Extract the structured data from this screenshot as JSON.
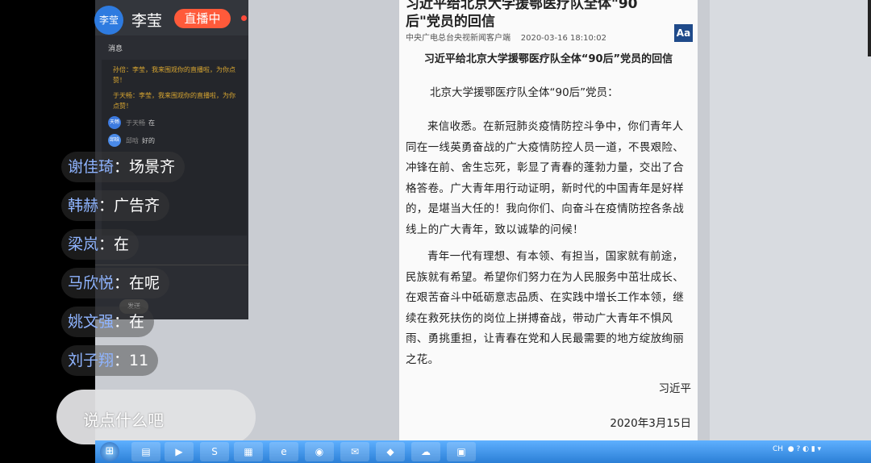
{
  "live": {
    "avatar_text": "李莹",
    "host_name": "李莹",
    "status_badge": "直播中"
  },
  "chat_panel": {
    "messages_label": "消息",
    "system_messages": [
      "孙倍：李莹，我来围观你的直播啦，为你点赞！",
      "于天畅：李莹，我来围观你的直播啦，为你点赞！"
    ],
    "user_messages": [
      {
        "avatar": "天畅",
        "name": "于天畅",
        "text": "在"
      },
      {
        "avatar": "邱晗",
        "name": "邱晗",
        "text": "好的"
      }
    ],
    "send_label": "发送"
  },
  "article": {
    "header_title": "习近平给北京大学援鄂医疗队全体\"90后\"党员的回信",
    "source": "中央广电总台央视新闻客户端",
    "datetime": "2020-03-16 18:10:02",
    "font_button": "Aa",
    "letter_title": "习近平给北京大学援鄂医疗队全体“90后”党员的回信",
    "salutation": "北京大学援鄂医疗队全体“90后”党员：",
    "paragraph1": "来信收悉。在新冠肺炎疫情防控斗争中，你们青年人同在一线英勇奋战的广大疫情防控人员一道，不畏艰险、冲锋在前、舍生忘死，彰显了青春的蓬勃力量，交出了合格答卷。广大青年用行动证明，新时代的中国青年是好样的，是堪当大任的！我向你们、向奋斗在疫情防控各条战线上的广大青年，致以诚挚的问候！",
    "paragraph2": "青年一代有理想、有本领、有担当，国家就有前途，民族就有希望。希望你们努力在为人民服务中茁壮成长、在艰苦奋斗中砥砺意志品质、在实践中增长工作本领，继续在救死扶伤的岗位上拼搏奋战，带动广大青年不惧风雨、勇挑重担，让青春在党和人民最需要的地方绽放绚丽之花。",
    "signature": "习近平",
    "date": "2020年3月15日"
  },
  "comments": [
    {
      "name": "谢佳琦",
      "text": "场景齐"
    },
    {
      "name": "韩赫",
      "text": "广告齐"
    },
    {
      "name": "梁岚",
      "text": "在"
    },
    {
      "name": "马欣悦",
      "text": "在呢"
    },
    {
      "name": "姚文强",
      "text": "在"
    },
    {
      "name": "刘子翔",
      "text": "11"
    }
  ],
  "comment_input": {
    "placeholder": "说点什么吧"
  },
  "taskbar": {
    "tray_text": "CH"
  }
}
